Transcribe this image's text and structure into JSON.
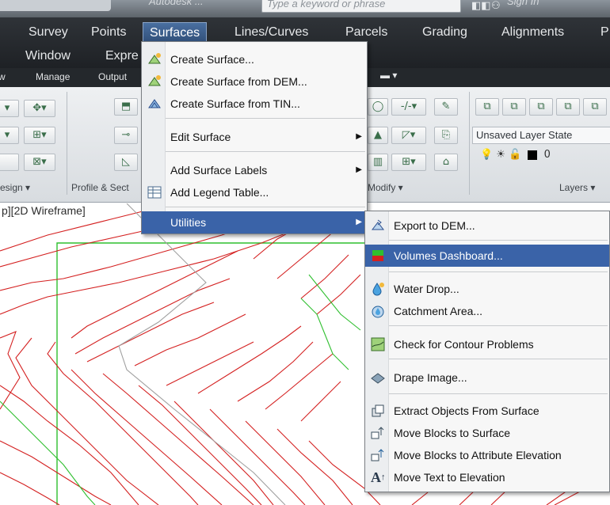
{
  "titlebar": {
    "ghost_text": "Autodesk ...",
    "search_placeholder": "Type a keyword or phrase",
    "sign_in": "Sign In"
  },
  "menubar": {
    "items": [
      "Survey",
      "Points",
      "Surfaces",
      "Lines/Curves",
      "Parcels",
      "Grading",
      "Alignments",
      "P",
      "Window",
      "Expre"
    ],
    "active": "Surfaces"
  },
  "ribbon": {
    "tabs": [
      "w",
      "Manage",
      "Output"
    ],
    "panels": [
      "esign ▾",
      "Profile & Sect",
      "Modify ▾",
      "Layers ▾"
    ],
    "layer_state": "Unsaved Layer State",
    "layer_value": "0"
  },
  "viewport_label": "p][2D Wireframe]",
  "surfaces_menu": {
    "items": [
      {
        "label": "Create Surface...",
        "icon": "create-surface-icon"
      },
      {
        "label": "Create Surface from DEM...",
        "icon": "surface-from-dem-icon"
      },
      {
        "label": "Create Surface from TIN...",
        "icon": "surface-from-tin-icon"
      },
      {
        "label": "Edit Surface",
        "icon": "",
        "submenu": true
      },
      {
        "label": "Add Surface Labels",
        "icon": "",
        "submenu": true
      },
      {
        "label": "Add Legend Table...",
        "icon": "legend-table-icon"
      },
      {
        "label": "Utilities",
        "icon": "",
        "submenu": true,
        "highlighted": true
      }
    ]
  },
  "utilities_menu": {
    "items": [
      {
        "label": "Export to DEM...",
        "icon": "export-dem-icon"
      },
      {
        "label": "Volumes Dashboard...",
        "icon": "volumes-dashboard-icon",
        "highlighted": true
      },
      {
        "label": "Water Drop...",
        "icon": "water-drop-icon"
      },
      {
        "label": "Catchment Area...",
        "icon": "catchment-area-icon"
      },
      {
        "label": "Check for Contour Problems",
        "icon": "check-contour-icon"
      },
      {
        "label": "Drape Image...",
        "icon": "drape-image-icon"
      },
      {
        "label": "Extract Objects From Surface",
        "icon": "extract-objects-icon"
      },
      {
        "label": "Move Blocks to Surface",
        "icon": "move-blocks-icon"
      },
      {
        "label": "Move Blocks to Attribute Elevation",
        "icon": "move-blocks-attr-icon"
      },
      {
        "label": "Move Text to Elevation",
        "icon": "move-text-icon"
      }
    ]
  },
  "colors": {
    "highlight": "#3a63a8",
    "contour_major": "#d42020",
    "contour_green": "#2fbf2f",
    "contour_gray": "#a0a0a0"
  }
}
